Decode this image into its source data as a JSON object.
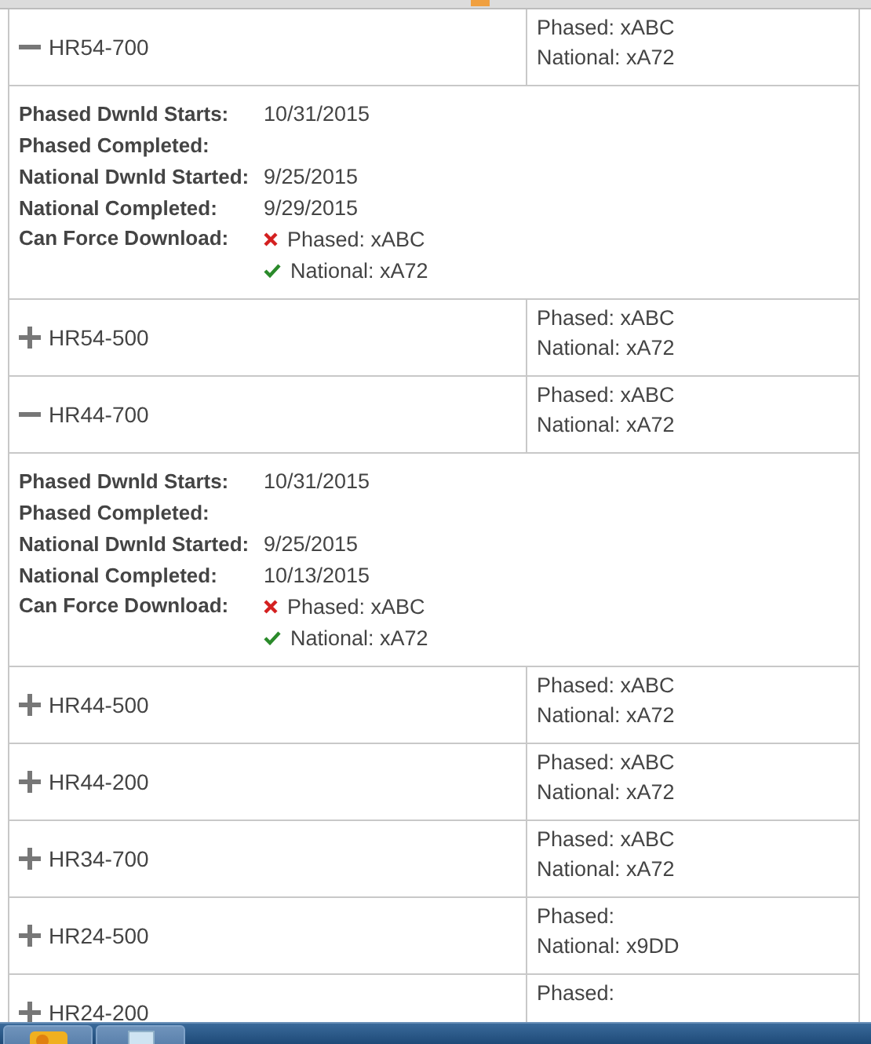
{
  "rows": [
    {
      "code": "HR54-700",
      "expanded": true,
      "phased": "Phased: xABC",
      "national": "National: xA72",
      "details": [
        {
          "label": "Phased Dwnld Starts:",
          "value": "10/31/2015"
        },
        {
          "label": "Phased Completed:"
        },
        {
          "label": "National Dwnld Started:",
          "value": "9/25/2015"
        },
        {
          "label": "National Completed:",
          "value": "9/29/2015"
        }
      ],
      "force": {
        "label": "Can Force Download:",
        "items": [
          {
            "text": "Phased: xABC",
            "ok": false
          },
          {
            "text": "National: xA72",
            "ok": true
          }
        ]
      }
    },
    {
      "code": "HR54-500",
      "expanded": false,
      "phased": "Phased: xABC",
      "national": "National: xA72"
    },
    {
      "code": "HR44-700",
      "expanded": true,
      "phased": "Phased: xABC",
      "national": "National: xA72",
      "details": [
        {
          "label": "Phased Dwnld Starts:",
          "value": "10/31/2015"
        },
        {
          "label": "Phased Completed:"
        },
        {
          "label": "National Dwnld Started:",
          "value": "9/25/2015"
        },
        {
          "label": "National Completed:",
          "value": "10/13/2015"
        }
      ],
      "force": {
        "label": "Can Force Download:",
        "items": [
          {
            "text": "Phased: xABC",
            "ok": false
          },
          {
            "text": "National: xA72",
            "ok": true
          }
        ]
      }
    },
    {
      "code": "HR44-500",
      "expanded": false,
      "phased": "Phased: xABC",
      "national": "National: xA72"
    },
    {
      "code": "HR44-200",
      "expanded": false,
      "phased": "Phased: xABC",
      "national": "National: xA72"
    },
    {
      "code": "HR34-700",
      "expanded": false,
      "phased": "Phased: xABC",
      "national": "National: xA72"
    },
    {
      "code": "HR24-500",
      "expanded": false,
      "phased": "Phased:",
      "national": "National: x9DD"
    },
    {
      "code": "HR24-200",
      "expanded": false,
      "phased": "Phased:"
    }
  ]
}
